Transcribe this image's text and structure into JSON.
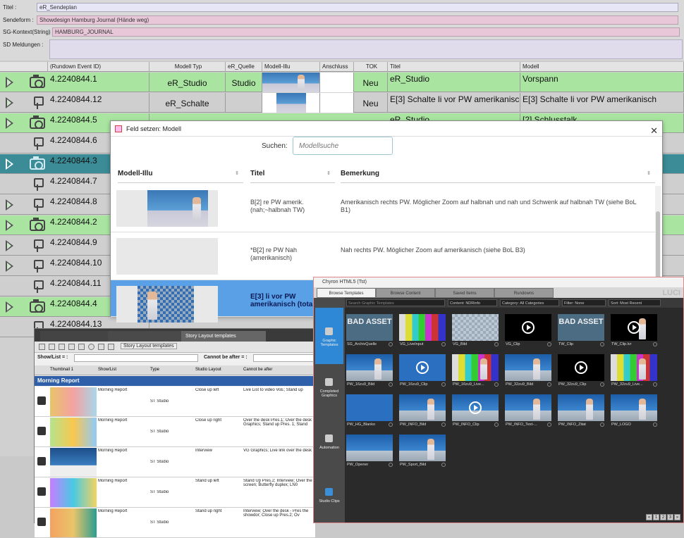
{
  "form": {
    "title_label": "Titel :",
    "title_value": "eR_Sendeplan",
    "sendeform_label": "Sendeform :",
    "sendeform_value": "Showdesign Hamburg Journal (Hände weg)",
    "sgkontext_label": "SG-Kontext(String) :",
    "sgkontext_value": "HAMBURG_JOURNAL",
    "meldungen_label": "SD Meldungen :"
  },
  "grid": {
    "headers": [
      "(Rundown Event ID)",
      "Modell Typ",
      "eR_Quelle",
      "Modell-Illu",
      "Anschluss",
      "TOK",
      "Titel",
      "Modell"
    ],
    "rows": [
      {
        "id": "4.2240844.1",
        "typ": "eR_Studio",
        "quelle": "Studio",
        "tok": "Neu",
        "titel": "eR_Studio",
        "modell": "Vorspann"
      },
      {
        "id": "4.2240844.12",
        "typ": "eR_Schalte",
        "quelle": "",
        "tok": "Neu",
        "titel": "E[3] Schalte li vor PW amerikanisch",
        "modell": "E[3] Schalte li vor PW amerikanisch"
      },
      {
        "id": "4.2240844.5",
        "typ": "",
        "quelle": "",
        "tok": "",
        "titel": "eR_Studio",
        "modell": "[2] Schlusstalk"
      },
      {
        "id": "4.2240844.6",
        "typ": "",
        "quelle": "",
        "tok": "",
        "titel": "",
        "modell": ""
      },
      {
        "id": "4.2240844.3",
        "typ": "",
        "quelle": "",
        "tok": "",
        "titel": "",
        "modell": ""
      },
      {
        "id": "4.2240844.7",
        "typ": "",
        "quelle": "",
        "tok": "",
        "titel": "",
        "modell": ""
      },
      {
        "id": "4.2240844.8",
        "typ": "",
        "quelle": "",
        "tok": "",
        "titel": "",
        "modell": ""
      },
      {
        "id": "4.2240844.2",
        "typ": "",
        "quelle": "",
        "tok": "",
        "titel": "",
        "modell": ""
      },
      {
        "id": "4.2240844.9",
        "typ": "",
        "quelle": "",
        "tok": "",
        "titel": "",
        "modell": ""
      },
      {
        "id": "4.2240844.10",
        "typ": "",
        "quelle": "",
        "tok": "",
        "titel": "",
        "modell": ""
      },
      {
        "id": "4.2240844.11",
        "typ": "",
        "quelle": "",
        "tok": "",
        "titel": "",
        "modell": ""
      },
      {
        "id": "4.2240844.4",
        "typ": "",
        "quelle": "",
        "tok": "",
        "titel": "",
        "modell": ""
      },
      {
        "id": "4.2240844.13",
        "typ": "",
        "quelle": "",
        "tok": "",
        "titel": "",
        "modell": ""
      }
    ]
  },
  "modal": {
    "title": "Feld setzen:  Modell",
    "close": "✕",
    "search_label": "Suchen:",
    "search_placeholder": "Modellsuche",
    "col_illu": "Modell-Illu",
    "col_titel": "Titel",
    "col_bemerkung": "Bemerkung",
    "rows": [
      {
        "titel": "B[2] re PW amerik. (nah;~halbnah TW)",
        "bemerkung": "Amerikanisch rechts PW. Möglicher Zoom auf halbnah und nah und Schwenk auf halbnah TW (siehe BoL B1)"
      },
      {
        "titel": "*B[2] re PW Nah (amerikanisch)",
        "bemerkung": "Nah rechts PW. Möglicher Zoom auf amerikanisch (siehe BoL B3)"
      },
      {
        "titel": "E[3] li vor PW amerikanisch (tota",
        "bemerkung": ""
      }
    ]
  },
  "story": {
    "tab_label": "Story Layout templates",
    "toolbar_label": "Story Layout templates",
    "show_list_label": "Show/List = :",
    "cannot_after_label": "Cannot be after = :",
    "columns": [
      "Thumbnail 1",
      "Show/List",
      "Type",
      "Studio Layout",
      "Cannot be after"
    ],
    "group": "Morning Report",
    "rows": [
      {
        "show": "Morning Report",
        "type": "ST Studio",
        "layout": "Close up left",
        "after": "Live List to video VoE; Stand up"
      },
      {
        "show": "Morning Report",
        "type": "ST Studio",
        "layout": "Close up right",
        "after": "Over the desk Pres.1; Over the desk Graphics; Stand up Pres. 1; Stand"
      },
      {
        "show": "Morning Report",
        "type": "ST Studio",
        "layout": "Interview",
        "after": "VG Graphics; Live link over the desk"
      },
      {
        "show": "Morning Report",
        "type": "ST Studio",
        "layout": "Stand up left",
        "after": "Stand Up Pres.2; Interview; Over the screen; Butterfly duplex; LN0"
      },
      {
        "show": "Morning Report",
        "type": "ST Studio",
        "layout": "Stand up right",
        "after": "Interview; Over the desk - Pres the showdor; Close up Pres.2; Ov"
      }
    ]
  },
  "chyron": {
    "title": "Chyron HTML5 (Tst)",
    "tabs": [
      "Browse Templates",
      "Browse Content",
      "Saved Items",
      "Rundowns"
    ],
    "luci": "LUCI",
    "search_placeholder": "Search Graphic Templates",
    "content_label": "Content:",
    "content_value": "NDRinfo",
    "category_label": "Category:",
    "category_value": "All Categories",
    "filter_label": "Filter:",
    "filter_value": "None",
    "sort_label": "Sort:",
    "sort_value": "Most Recent",
    "side": [
      "Graphic Templates",
      "Completed Graphics",
      "Automation",
      "Studio Clips"
    ],
    "tiles": [
      {
        "label": "SG_ArchivQuelle",
        "kind": "badasset",
        "text": "BAD ASSET"
      },
      {
        "label": "VG_LiveInput",
        "kind": "bars",
        "text": ""
      },
      {
        "label": "VG_Bild",
        "kind": "checker",
        "text": ""
      },
      {
        "label": "VG_Clip",
        "kind": "black-play",
        "text": ""
      },
      {
        "label": "TW_Clip",
        "kind": "badasset",
        "text": "BAD ASSET"
      },
      {
        "label": "TW_Clip.lvr",
        "kind": "black-play-pres",
        "text": ""
      },
      {
        "label": "PW_16zu9_Bild",
        "kind": "studio-pres",
        "text": ""
      },
      {
        "label": "PW_16zu9_Clip",
        "kind": "blue-play",
        "text": ""
      },
      {
        "label": "PW_16zu9_Live...",
        "kind": "bars-pres",
        "text": ""
      },
      {
        "label": "PW_32zu9_Bild",
        "kind": "studio-pres",
        "text": ""
      },
      {
        "label": "PW_32zu9_Clip",
        "kind": "black-play",
        "text": ""
      },
      {
        "label": "PW_32zu9_Live...",
        "kind": "bars-pres",
        "text": ""
      },
      {
        "label": "PW_HG_Blanko",
        "kind": "blue",
        "text": ""
      },
      {
        "label": "PW_INFO_Bild",
        "kind": "studio-pres",
        "text": ""
      },
      {
        "label": "PW_INFO_Clip",
        "kind": "studio-play",
        "text": ""
      },
      {
        "label": "PW_INFO_Text-...",
        "kind": "studio-pres",
        "text": ""
      },
      {
        "label": "PW_INFO_Zitat",
        "kind": "studio-pres",
        "text": ""
      },
      {
        "label": "PW_LOGO",
        "kind": "studio-pres",
        "text": ""
      },
      {
        "label": "PW_Opener",
        "kind": "studio",
        "text": ""
      },
      {
        "label": "PW_Sport_Bild",
        "kind": "studio-pres",
        "text": ""
      }
    ],
    "pages": [
      "«",
      "1",
      "2",
      "3",
      "»"
    ]
  }
}
